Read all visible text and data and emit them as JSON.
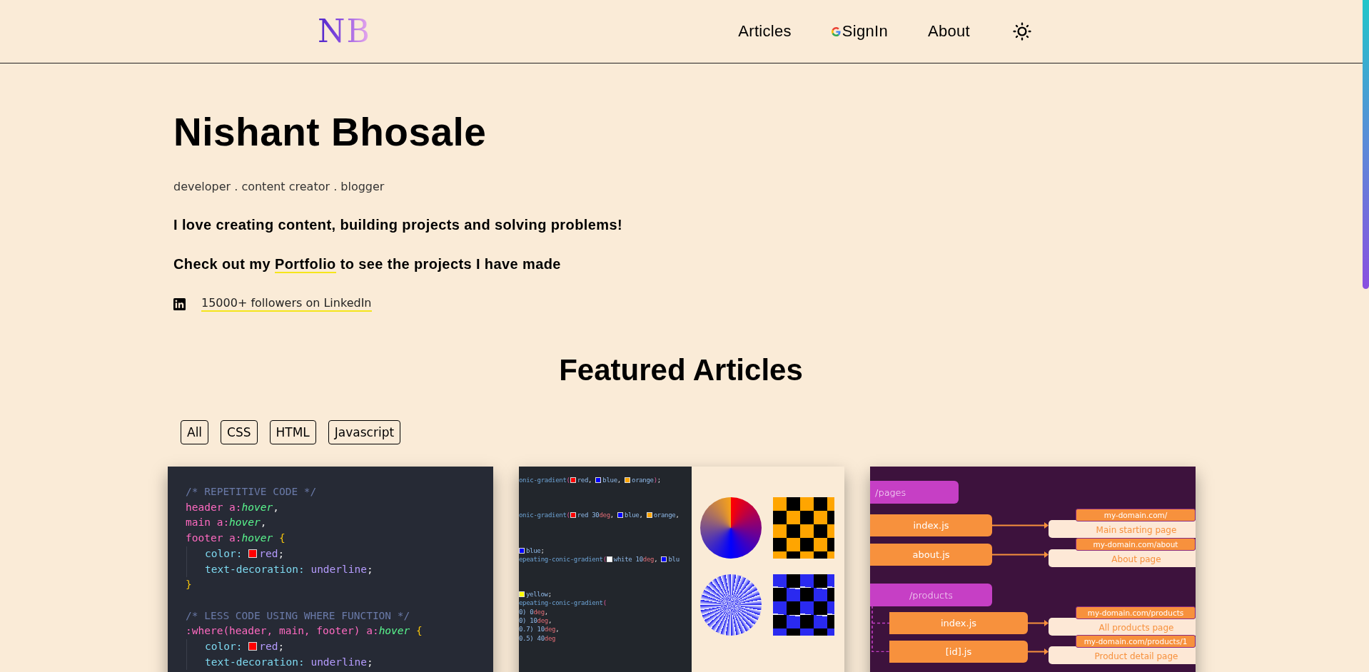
{
  "header": {
    "logo": "NB",
    "nav": [
      {
        "label": "Articles",
        "kind": "link"
      },
      {
        "label": "SignIn",
        "kind": "google"
      },
      {
        "label": "About",
        "kind": "link"
      }
    ]
  },
  "hero": {
    "name": "Nishant Bhosale",
    "tagline": "developer . content creator . blogger",
    "intro": "I love creating content, building projects and solving problems!",
    "portfolio": {
      "before": "Check out my ",
      "link": "Portfolio",
      "after": " to see the projects I have made"
    },
    "linkedin": "15000+ followers on LinkedIn"
  },
  "featured": {
    "title": "Featured Articles",
    "filters": [
      "All",
      "CSS",
      "HTML",
      "Javascript"
    ],
    "articles": [
      {
        "kind": "code",
        "blocks": [
          [
            {
              "indent": false,
              "tokens": [
                {
                  "t": "/* REPETITIVE CODE */",
                  "kind": "comment"
                }
              ]
            },
            {
              "indent": false,
              "tokens": [
                {
                  "t": "header a:",
                  "kind": "sel"
                },
                {
                  "t": "hover",
                  "kind": "pseudo"
                },
                {
                  "t": ",",
                  "kind": "plain"
                }
              ]
            },
            {
              "indent": false,
              "tokens": [
                {
                  "t": "main a:",
                  "kind": "sel"
                },
                {
                  "t": "hover",
                  "kind": "pseudo"
                },
                {
                  "t": ",",
                  "kind": "plain"
                }
              ]
            },
            {
              "indent": false,
              "tokens": [
                {
                  "t": "footer a:",
                  "kind": "sel"
                },
                {
                  "t": "hover",
                  "kind": "pseudo"
                },
                {
                  "t": " {",
                  "kind": "brace"
                }
              ]
            },
            {
              "indent": true,
              "tokens": [
                {
                  "t": "color: ",
                  "kind": "prop"
                },
                {
                  "kind": "swatch",
                  "color": "#ff0000"
                },
                {
                  "t": "red",
                  "kind": "val"
                },
                {
                  "t": ";",
                  "kind": "plain"
                }
              ]
            },
            {
              "indent": true,
              "tokens": [
                {
                  "t": "text-decoration: ",
                  "kind": "prop"
                },
                {
                  "t": "underline",
                  "kind": "val"
                },
                {
                  "t": ";",
                  "kind": "plain"
                }
              ]
            },
            {
              "indent": false,
              "tokens": [
                {
                  "t": "}",
                  "kind": "brace"
                }
              ]
            }
          ],
          [
            {
              "indent": false,
              "tokens": [
                {
                  "t": "/* LESS CODE USING WHERE FUNCTION */",
                  "kind": "comment"
                }
              ]
            },
            {
              "indent": false,
              "tokens": [
                {
                  "t": ":where(header, main, footer) a:",
                  "kind": "sel"
                },
                {
                  "t": "hover",
                  "kind": "pseudo"
                },
                {
                  "t": " {",
                  "kind": "brace"
                }
              ]
            },
            {
              "indent": true,
              "tokens": [
                {
                  "t": "color: ",
                  "kind": "prop"
                },
                {
                  "kind": "swatch",
                  "color": "#ff0000"
                },
                {
                  "t": "red",
                  "kind": "val"
                },
                {
                  "t": ";",
                  "kind": "plain"
                }
              ]
            },
            {
              "indent": true,
              "tokens": [
                {
                  "t": "text-decoration: ",
                  "kind": "prop"
                },
                {
                  "t": "underline",
                  "kind": "val"
                },
                {
                  "t": ";",
                  "kind": "plain"
                }
              ]
            }
          ]
        ]
      },
      {
        "kind": "gradients",
        "blocks": [
          [
            {
              "indent": false,
              "tokens": [
                {
                  "t": "onic-gradient",
                  "kind": "fn"
                },
                {
                  "t": "(",
                  "kind": "paren"
                },
                {
                  "kind": "swatch",
                  "color": "#ff0000"
                },
                {
                  "t": "red",
                  "kind": "val"
                },
                {
                  "t": ", ",
                  "kind": "plain"
                },
                {
                  "kind": "swatch",
                  "color": "#0000ff"
                },
                {
                  "t": "blue",
                  "kind": "val"
                },
                {
                  "t": ", ",
                  "kind": "plain"
                },
                {
                  "kind": "swatch",
                  "color": "#ffa500"
                },
                {
                  "t": "orange",
                  "kind": "val"
                },
                {
                  "t": ")",
                  "kind": "paren"
                },
                {
                  "t": ";",
                  "kind": "plain"
                }
              ]
            }
          ],
          [
            {
              "indent": false,
              "tokens": [
                {
                  "t": "onic-gradient",
                  "kind": "fn"
                },
                {
                  "t": "(",
                  "kind": "paren"
                },
                {
                  "kind": "swatch",
                  "color": "#ff0000"
                },
                {
                  "t": "red 30",
                  "kind": "val"
                },
                {
                  "t": "deg",
                  "kind": "unit"
                },
                {
                  "t": ", ",
                  "kind": "plain"
                },
                {
                  "kind": "swatch",
                  "color": "#0000ff"
                },
                {
                  "t": "blue",
                  "kind": "val"
                },
                {
                  "t": ", ",
                  "kind": "plain"
                },
                {
                  "kind": "swatch",
                  "color": "#ffa500"
                },
                {
                  "t": "orange",
                  "kind": "val"
                },
                {
                  "t": ",",
                  "kind": "plain"
                }
              ]
            }
          ],
          [
            {
              "indent": false,
              "tokens": [
                {
                  "kind": "swatch",
                  "color": "#0000ff"
                },
                {
                  "t": "blue",
                  "kind": "val"
                },
                {
                  "t": ";",
                  "kind": "plain"
                }
              ]
            },
            {
              "indent": false,
              "tokens": [
                {
                  "t": "epeating-conic-gradient",
                  "kind": "fn"
                },
                {
                  "t": "(",
                  "kind": "paren"
                },
                {
                  "kind": "swatch",
                  "color": "#ffffff"
                },
                {
                  "t": "white 10",
                  "kind": "val"
                },
                {
                  "t": "deg",
                  "kind": "unit"
                },
                {
                  "t": ", ",
                  "kind": "plain"
                },
                {
                  "kind": "swatch",
                  "color": "#0000ff"
                },
                {
                  "t": "blu",
                  "kind": "val"
                }
              ]
            }
          ],
          [
            {
              "indent": false,
              "tokens": [
                {
                  "kind": "swatch",
                  "color": "#ffff00"
                },
                {
                  "t": "yellow",
                  "kind": "val"
                },
                {
                  "t": ";",
                  "kind": "plain"
                }
              ]
            },
            {
              "indent": false,
              "tokens": [
                {
                  "t": "epeating-conic-gradient",
                  "kind": "fn"
                },
                {
                  "t": "(",
                  "kind": "paren"
                }
              ]
            },
            {
              "indent": false,
              "tokens": [
                {
                  "t": "0) 0",
                  "kind": "val"
                },
                {
                  "t": "deg",
                  "kind": "unit"
                },
                {
                  "t": ",",
                  "kind": "plain"
                }
              ]
            },
            {
              "indent": false,
              "tokens": [
                {
                  "t": "0) 10",
                  "kind": "val"
                },
                {
                  "t": "deg",
                  "kind": "unit"
                },
                {
                  "t": ",",
                  "kind": "plain"
                }
              ]
            },
            {
              "indent": false,
              "tokens": [
                {
                  "t": "0.7) 10",
                  "kind": "val"
                },
                {
                  "t": "deg",
                  "kind": "unit"
                },
                {
                  "t": ",",
                  "kind": "plain"
                }
              ]
            },
            {
              "indent": false,
              "tokens": [
                {
                  "t": "0.5) 40",
                  "kind": "val"
                },
                {
                  "t": "deg",
                  "kind": "unit"
                }
              ]
            }
          ]
        ]
      },
      {
        "kind": "routes",
        "folders": [
          {
            "name": "/pages",
            "files": [
              {
                "name": "index.js",
                "url": "my-domain.com/",
                "page": "Main starting page"
              },
              {
                "name": "about.js",
                "url": "my-domain.com/about",
                "page": "About page"
              }
            ]
          },
          {
            "name": "/products",
            "files": [
              {
                "name": "index.js",
                "url": "my-domain.com/products",
                "page": "All products page"
              },
              {
                "name": "[id].js",
                "url": "my-domain.com/products/1",
                "page": "Product detail page"
              }
            ]
          }
        ]
      }
    ]
  }
}
